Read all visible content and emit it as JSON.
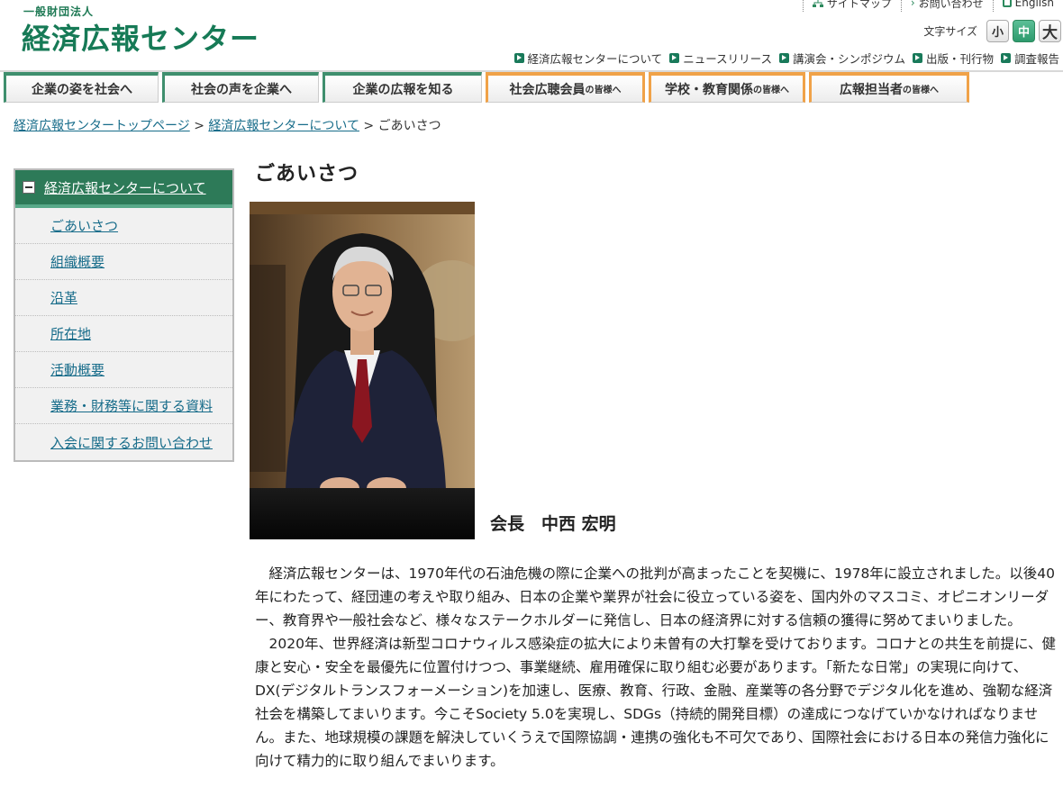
{
  "header": {
    "org_type": "一般財団法人",
    "org_name": "経済広報センター",
    "util_links": [
      {
        "label": "サイトマップ",
        "icon": "sitemap-icon"
      },
      {
        "label": "お問い合わせ",
        "icon": "arrow-icon"
      },
      {
        "label": "English",
        "icon": "document-icon"
      }
    ],
    "fontsize": {
      "label": "文字サイズ",
      "small": "小",
      "medium": "中",
      "large": "大",
      "active": "medium"
    },
    "subnav": [
      "経済広報センターについて",
      "ニュースリリース",
      "講演会・シンポジウム",
      "出版・刊行物",
      "調査報告"
    ]
  },
  "global_nav": [
    {
      "label": "企業の姿を社会へ",
      "suffix": "",
      "style": "green"
    },
    {
      "label": "社会の声を企業へ",
      "suffix": "",
      "style": "green"
    },
    {
      "label": "企業の広報を知る",
      "suffix": "",
      "style": "green"
    },
    {
      "label": "社会広聴会員",
      "suffix": "の皆様へ",
      "style": "orange"
    },
    {
      "label": "学校・教育関係",
      "suffix": "の皆様へ",
      "style": "orange"
    },
    {
      "label": "広報担当者",
      "suffix": "の皆様へ",
      "style": "orange"
    }
  ],
  "breadcrumb": {
    "home": "経済広報センタートップページ",
    "parent": "経済広報センターについて",
    "current": "ごあいさつ",
    "separator": ">"
  },
  "sidebar": {
    "heading": "経済広報センターについて",
    "items": [
      "ごあいさつ",
      "組織概要",
      "沿革",
      "所在地",
      "活動概要",
      "業務・財務等に関する資料",
      "入会に関するお問い合わせ"
    ]
  },
  "main": {
    "title": "ごあいさつ",
    "photo_caption": "会長　中西 宏明",
    "paragraphs": [
      "経済広報センターは、1970年代の石油危機の際に企業への批判が高まったことを契機に、1978年に設立されました。以後40年にわたって、経団連の考えや取り組み、日本の企業や業界が社会に役立っている姿を、国内外のマスコミ、オピニオンリーダー、教育界や一般社会など、様々なステークホルダーに発信し、日本の経済界に対する信頼の獲得に努めてまいりました。",
      "2020年、世界経済は新型コロナウィルス感染症の拡大により未曽有の大打撃を受けております。コロナとの共生を前提に、健康と安心・安全を最優先に位置付けつつ、事業継続、雇用確保に取り組む必要があります。「新たな日常」の実現に向けて、DX(デジタルトランスフォーメーション)を加速し、医療、教育、行政、金融、産業等の各分野でデジタル化を進め、強靭な経済社会を構築してまいります。今こそSociety 5.0を実現し、SDGs（持続的開発目標）の達成につなげていかなければなりません。また、地球規模の課題を解決していくうえで国際協調・連携の強化も不可欠であり、国際社会における日本の発信力強化に向けて精力的に取り組んでまいります。"
    ]
  },
  "colors": {
    "brand_green": "#167a56",
    "nav_orange": "#f0a248",
    "link_blue": "#176c8a"
  }
}
